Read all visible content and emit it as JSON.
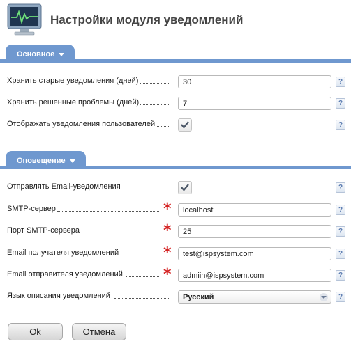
{
  "page": {
    "title": "Настройки модуля уведомлений"
  },
  "sections": {
    "main": {
      "label": "Основное",
      "fields": {
        "keep_old": {
          "label": "Хранить старые уведомления (дней)",
          "value": "30"
        },
        "keep_resolved": {
          "label": "Хранить решенные проблемы (дней)",
          "value": "7"
        },
        "show_user": {
          "label": "Отображать уведомления пользователей",
          "checked": true
        }
      }
    },
    "alert": {
      "label": "Оповещение",
      "fields": {
        "send_email": {
          "label": "Отправлять Email-уведомления",
          "checked": true
        },
        "smtp_server": {
          "label": "SMTP-сервер",
          "value": "localhost"
        },
        "smtp_port": {
          "label": "Порт SMTP-сервера",
          "value": "25"
        },
        "email_to": {
          "label": "Email получателя уведомлений",
          "value": "test@ispsystem.com"
        },
        "email_from": {
          "label": "Email отправителя уведомлений",
          "value": "admiin@ispsystem.com"
        },
        "language": {
          "label": "Язык описания уведомлений",
          "value": "Русский"
        }
      }
    }
  },
  "common": {
    "help": "?",
    "required_mark": "*"
  },
  "buttons": {
    "ok": "Ok",
    "cancel": "Отмена"
  },
  "colors": {
    "accent": "#6f98cf",
    "required": "#d42020"
  }
}
